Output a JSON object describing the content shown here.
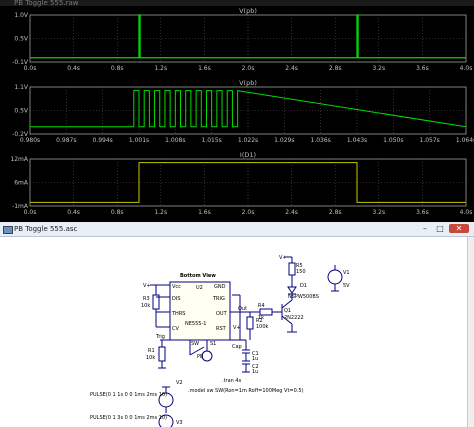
{
  "plot_window": {
    "title": "PB Toggle 555.raw"
  },
  "chart_data": [
    {
      "type": "line",
      "title": "V(pb)",
      "y_tick_labels": [
        "1.0V",
        "0.5V",
        "-0.1V"
      ],
      "x_tick_labels": [
        "0.0s",
        "0.4s",
        "0.8s",
        "1.2s",
        "1.6s",
        "2.0s",
        "2.4s",
        "2.8s",
        "3.2s",
        "3.6s",
        "4.0s"
      ],
      "xlim": [
        0,
        4.0
      ],
      "ylim": [
        -0.1,
        1.0
      ],
      "series": [
        {
          "color": "#00dd00",
          "x": [
            0,
            1.0,
            1.0,
            1.01,
            1.01,
            3.0,
            3.0,
            3.01,
            3.01,
            4.0
          ],
          "y": [
            0,
            0,
            1.0,
            1.0,
            0,
            0,
            1.0,
            1.0,
            0,
            0
          ]
        }
      ]
    },
    {
      "type": "line",
      "title": "V(pb)",
      "y_tick_labels": [
        "1.1V",
        "0.5V",
        "-0.2V"
      ],
      "x_tick_labels": [
        "0.980s",
        "0.987s",
        "0.994s",
        "1.001s",
        "1.008s",
        "1.015s",
        "1.022s",
        "1.029s",
        "1.036s",
        "1.043s",
        "1.050s",
        "1.057s",
        "1.064s"
      ],
      "xlim": [
        0.98,
        1.064
      ],
      "ylim": [
        -0.2,
        1.1
      ],
      "series": [
        {
          "color": "#00dd00",
          "x": [
            0.98,
            1.0,
            1.0,
            1.001,
            1.001,
            1.002,
            1.002,
            1.003,
            1.003,
            1.004,
            1.004,
            1.005,
            1.005,
            1.006,
            1.006,
            1.007,
            1.007,
            1.008,
            1.008,
            1.009,
            1.009,
            1.01,
            1.01,
            1.011,
            1.011,
            1.012,
            1.012,
            1.013,
            1.013,
            1.014,
            1.014,
            1.015,
            1.015,
            1.016,
            1.016,
            1.017,
            1.017,
            1.018,
            1.018,
            1.019,
            1.019,
            1.02,
            1.02,
            1.064
          ],
          "y": [
            0,
            0,
            1.0,
            1.0,
            0,
            0,
            1.0,
            1.0,
            0,
            0,
            1.0,
            1.0,
            0,
            0,
            1.0,
            1.0,
            0,
            0,
            1.0,
            1.0,
            0,
            0,
            1.0,
            1.0,
            0,
            0,
            1.0,
            1.0,
            0,
            0,
            1.0,
            1.0,
            0,
            0,
            1.0,
            1.0,
            0,
            0,
            1.0,
            1.0,
            0,
            0,
            1.0,
            0
          ]
        }
      ]
    },
    {
      "type": "line",
      "title": "I(D1)",
      "y_tick_labels": [
        "12mA",
        "6mA",
        "-1mA"
      ],
      "x_tick_labels": [
        "0.0s",
        "0.4s",
        "0.8s",
        "1.2s",
        "1.6s",
        "2.0s",
        "2.4s",
        "2.8s",
        "3.2s",
        "3.6s",
        "4.0s"
      ],
      "xlim": [
        0,
        4.0
      ],
      "ylim": [
        -1,
        12
      ],
      "series": [
        {
          "color": "#c8c800",
          "x": [
            0,
            1.0,
            1.0,
            3.0,
            3.0,
            4.0
          ],
          "y": [
            0,
            0,
            11,
            11,
            0,
            0
          ]
        }
      ]
    }
  ],
  "schematic": {
    "title": "PB Toggle 555.asc",
    "ic": {
      "header": "Bottom View",
      "ref": "U2",
      "part": "NE555-1",
      "pins": {
        "vcc": "Vcc",
        "gnd": "GND",
        "dis": "DIS",
        "trig": "TRIG",
        "thrs": "THRS",
        "out": "OUT",
        "cv": "CV",
        "rst": "RST"
      }
    },
    "labels": {
      "vplus_1": "V+",
      "vplus_2": "V+",
      "vplus_3": "V+",
      "r3": "R3",
      "r3v": "10k",
      "r1": "R1",
      "r1v": "10k",
      "r2": "R2",
      "r2v": "100k",
      "r4": "R4",
      "r4v": "1k",
      "r5": "R5",
      "r5v": "150",
      "c1": "C1",
      "c1v": "1u",
      "c2": "C2",
      "c2v": "1u",
      "cap": "Cap",
      "out": "Out",
      "trig": "Trig",
      "sw": "SW",
      "s1": "S1",
      "pb": "PB",
      "d1": "D1",
      "d1p": "NSPW500BS",
      "q1": "Q1",
      "q1p": "2N2222",
      "v1": "V1",
      "v1v": "5V",
      "v2": "V2",
      "v3": "V3",
      "pulse1": "PULSE(0 1 1s 0 0 1ms 2ms 10)",
      "pulse2": "PULSE(0 1 3s 0 0 1ms 2ms 10)",
      "tran": ".tran 4s",
      "model": ".model sw SW(Ron=1m Roff=100Meg Vt=0.5)"
    }
  }
}
